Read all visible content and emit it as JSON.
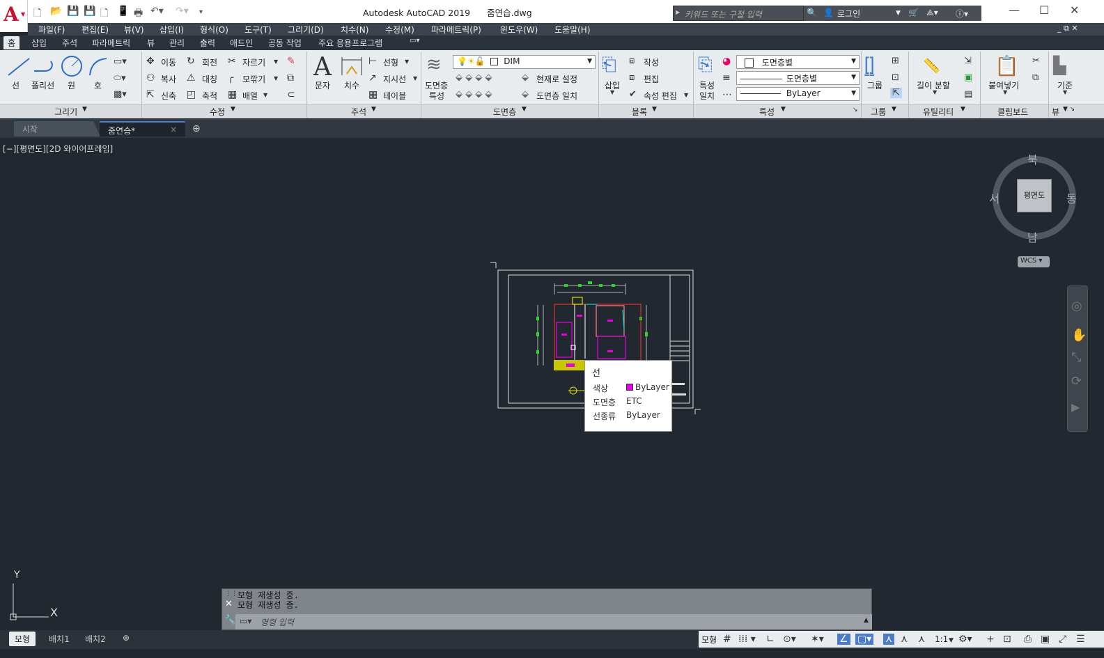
{
  "app": {
    "title": "Autodesk AutoCAD 2019",
    "filename": "줌연습.dwg",
    "logo": "A"
  },
  "search": {
    "placeholder": "키워드 또는 구절 입력"
  },
  "account": {
    "login": "로그인"
  },
  "menu": [
    "파일(F)",
    "편집(E)",
    "뷰(V)",
    "삽입(I)",
    "형식(O)",
    "도구(T)",
    "그리기(D)",
    "치수(N)",
    "수정(M)",
    "파라메트릭(P)",
    "윈도우(W)",
    "도움말(H)"
  ],
  "ribbon_tabs": [
    "홈",
    "삽입",
    "주석",
    "파라메트릭",
    "뷰",
    "관리",
    "출력",
    "애드인",
    "공동 작업",
    "주요 응용프로그램"
  ],
  "draw_panel": {
    "line": "선",
    "polyline": "폴리선",
    "circle": "원",
    "arc": "호",
    "title": "그리기"
  },
  "modify_panel": {
    "move": "이동",
    "rotate": "회전",
    "trim": "자르기",
    "copy": "복사",
    "mirror": "대칭",
    "fillet": "모깎기",
    "stretch": "신축",
    "scale": "축척",
    "array": "배열",
    "title": "수정"
  },
  "annotation_panel": {
    "text": "문자",
    "dimension": "치수",
    "linear": "선형",
    "leader": "지시선",
    "table": "테이블",
    "title": "주석"
  },
  "layers_panel": {
    "properties_line1": "도면층",
    "properties_line2": "특성",
    "current_layer": "DIM",
    "make_current": "현재로 설정",
    "match_layer": "도면층 일치",
    "title": "도면층"
  },
  "block_panel": {
    "insert": "삽입",
    "create": "작성",
    "edit": "편집",
    "edit_attributes": "속성 편집",
    "title": "블록"
  },
  "properties_panel": {
    "match_line1": "특성",
    "match_line2": "일치",
    "color": "도면층별",
    "lineweight": "도면층별",
    "linetype": "ByLayer",
    "title": "특성"
  },
  "groups_panel": {
    "group": "그룹",
    "title": "그룹"
  },
  "utilities_panel": {
    "measure": "길이 분할",
    "title": "유틸리티"
  },
  "clipboard_panel": {
    "paste": "붙여넣기",
    "title": "클립보드"
  },
  "view_panel": {
    "base": "기준",
    "title": "뷰"
  },
  "doc_tabs": {
    "start": "시작",
    "current": "줌연습*"
  },
  "viewport": {
    "label": "[−][평면도][2D 와이어프레임]"
  },
  "viewcube": {
    "north": "북",
    "south": "남",
    "east": "동",
    "west": "서",
    "face": "평면도",
    "wcs": "WCS"
  },
  "tooltip": {
    "title": "선",
    "rows": [
      {
        "key": "색상",
        "value": "ByLayer"
      },
      {
        "key": "도면층",
        "value": "ETC"
      },
      {
        "key": "선종류",
        "value": "ByLayer"
      }
    ],
    "swatch_color": "#e600e6"
  },
  "command": {
    "history": [
      "모형 재생성 중.",
      "모형 재생성 중."
    ],
    "placeholder": "명령 입력"
  },
  "layout_tabs": [
    "모형",
    "배치1",
    "배치2"
  ],
  "status": {
    "model": "모형",
    "scale": "1:1"
  },
  "ucs": {
    "x": "X",
    "y": "Y"
  }
}
